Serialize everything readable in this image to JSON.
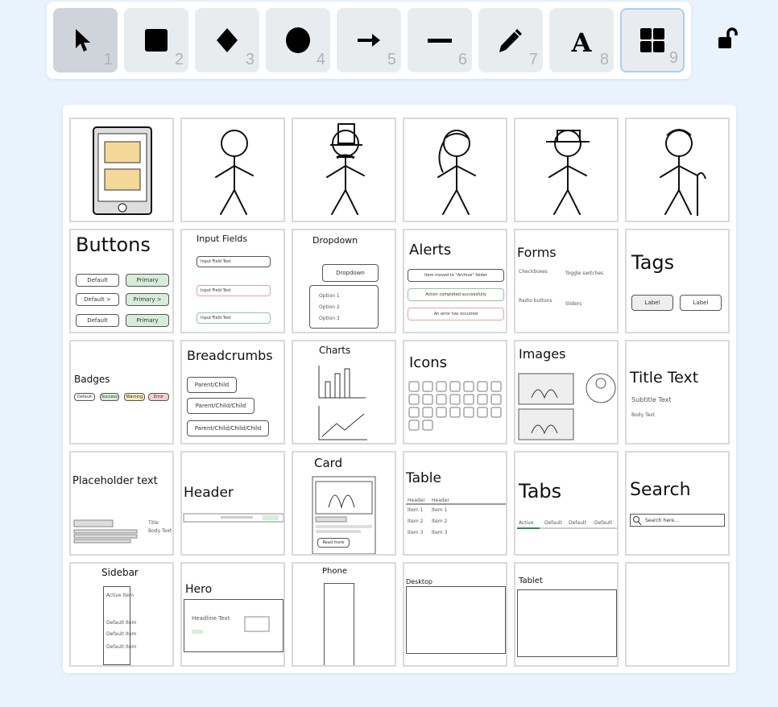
{
  "toolbar": {
    "tools": [
      {
        "name": "selection",
        "icon": "pointer-icon",
        "shortcut": "1",
        "active": true
      },
      {
        "name": "rectangle",
        "icon": "square-icon",
        "shortcut": "2"
      },
      {
        "name": "diamond",
        "icon": "diamond-icon",
        "shortcut": "3"
      },
      {
        "name": "ellipse",
        "icon": "circle-icon",
        "shortcut": "4"
      },
      {
        "name": "arrow",
        "icon": "arrow-right-icon",
        "shortcut": "5"
      },
      {
        "name": "line",
        "icon": "line-icon",
        "shortcut": "6"
      },
      {
        "name": "draw",
        "icon": "pencil-icon",
        "shortcut": "7"
      },
      {
        "name": "text",
        "icon": "text-a-icon",
        "shortcut": "8"
      },
      {
        "name": "library",
        "icon": "grid-icon",
        "shortcut": "9",
        "focused": true
      }
    ],
    "lock_icon": "unlocked-padlock-icon"
  },
  "colors": {
    "background": "#e9f3fe",
    "tool_bg": "#e9ecef",
    "tool_active": "#ced4da",
    "focus_ring": "#a5d0f5",
    "green_fill": "#d6eed9",
    "red_border": "#e8a0a0"
  },
  "library": {
    "items": [
      {
        "kind": "tablet"
      },
      {
        "kind": "stick"
      },
      {
        "kind": "stick-tophat"
      },
      {
        "kind": "stick-ponytail"
      },
      {
        "kind": "stick-hat"
      },
      {
        "kind": "stick-cane"
      },
      {
        "kind": "buttons",
        "title": "Buttons",
        "labels": [
          "Default",
          "Primary",
          "Default >",
          "Primary >",
          "Default",
          "Primary"
        ]
      },
      {
        "kind": "inputs",
        "title": "Input Fields",
        "labels": [
          "Input Field Text",
          "Input Field Text",
          "Input Field Text"
        ]
      },
      {
        "kind": "dropdown",
        "title": "Dropdown",
        "labels": [
          "Dropdown",
          "Option 1",
          "Option 2",
          "Option 3"
        ]
      },
      {
        "kind": "alerts",
        "title": "Alerts",
        "labels": [
          "Item moved to \"Archive\" folder",
          "Action completed successfully",
          "An error has occurred"
        ]
      },
      {
        "kind": "forms",
        "title": "Forms",
        "labels": [
          "Checkboxes",
          "Toggle switches",
          "Radio buttons",
          "Sliders"
        ]
      },
      {
        "kind": "tags",
        "title": "Tags",
        "labels": [
          "Label",
          "Label"
        ]
      },
      {
        "kind": "badges",
        "title": "Badges",
        "labels": [
          "Default",
          "Success",
          "Warning",
          "Error"
        ]
      },
      {
        "kind": "breadcrumbs",
        "title": "Breadcrumbs",
        "labels": [
          "Parent/Child",
          "Parent/Child/Child",
          "Parent/Child/Child/Child"
        ]
      },
      {
        "kind": "charts",
        "title": "Charts"
      },
      {
        "kind": "icons",
        "title": "Icons"
      },
      {
        "kind": "images",
        "title": "Images"
      },
      {
        "kind": "titletext",
        "title": "Title Text",
        "labels": [
          "Subtitle Text",
          "Body Text"
        ]
      },
      {
        "kind": "placeholder",
        "title": "Placeholder text",
        "labels": [
          "Title",
          "Body Text"
        ]
      },
      {
        "kind": "header",
        "title": "Header"
      },
      {
        "kind": "card",
        "title": "Card",
        "labels": [
          "Read more"
        ]
      },
      {
        "kind": "table",
        "title": "Table",
        "labels": [
          "Header",
          "Header",
          "Item 1",
          "Item 1",
          "Item 2",
          "Item 2",
          "Item 3",
          "Item 3"
        ]
      },
      {
        "kind": "tabs",
        "title": "Tabs",
        "labels": [
          "Active",
          "Default",
          "Default",
          "Default"
        ]
      },
      {
        "kind": "search",
        "title": "Search",
        "labels": [
          "Search here..."
        ]
      },
      {
        "kind": "sidebar",
        "title": "Sidebar",
        "labels": [
          "Active Item",
          "Default Item",
          "Default Item",
          "Default Item"
        ]
      },
      {
        "kind": "hero",
        "title": "Hero",
        "labels": [
          "Headline Text"
        ]
      },
      {
        "kind": "phone",
        "title": "Phone"
      },
      {
        "kind": "desktop",
        "title": "Desktop"
      },
      {
        "kind": "tabletframe",
        "title": "Tablet"
      },
      {
        "kind": "empty"
      }
    ]
  }
}
